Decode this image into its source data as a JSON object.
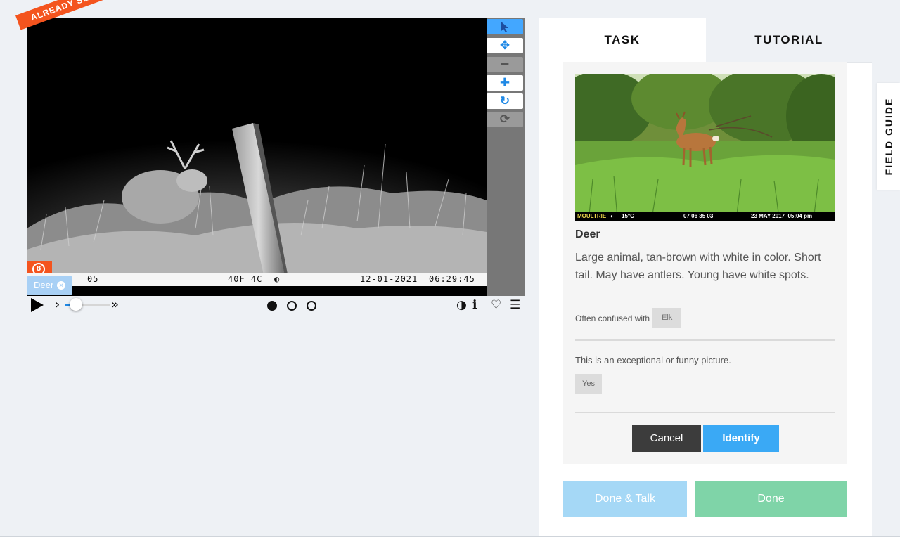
{
  "viewer": {
    "banner": "ALREADY SEEN!",
    "camera_strip": {
      "left": "05",
      "temp": "40F 4C",
      "date": "12-01-2021",
      "time": "06:29:45"
    },
    "badge_glyph": "8",
    "tag": {
      "label": "Deer"
    }
  },
  "toolbar": {
    "buttons": [
      "pointer-icon",
      "move-icon",
      "zoom-out-icon",
      "zoom-in-icon",
      "rotate-icon",
      "reset-icon"
    ]
  },
  "controls": {
    "play_glyph": "▶",
    "step_glyph": "›",
    "fast_glyph": "»",
    "frames": 3,
    "current_frame": 1,
    "icons": [
      "invert-icon",
      "info-icon",
      "heart-icon",
      "collections-icon"
    ]
  },
  "tabs": {
    "task": "TASK",
    "tutorial": "TUTORIAL"
  },
  "species_card": {
    "example_strip": {
      "brand": "MOULTRIE",
      "temp": "15°C",
      "code": "07 06 35 03",
      "datetime": "23 MAY 2017  05:04 pm"
    },
    "name": "Deer",
    "description": "Large animal, tan-brown with white in color. Short tail. May have antlers. Young have white spots.",
    "confused_label": "Often confused with",
    "confused_with": [
      "Elk"
    ],
    "question": "This is an exceptional or funny picture.",
    "answer_yes": "Yes",
    "cancel": "Cancel",
    "identify": "Identify"
  },
  "footer_buttons": {
    "done_talk": "Done & Talk",
    "done": "Done"
  },
  "field_guide": "FIELD GUIDE",
  "colors": {
    "accent": "#3aa9f5",
    "banner": "#f4541e",
    "done": "#7fd4a8",
    "done_talk": "#a5d8f6",
    "cancel": "#3c3c3c"
  }
}
